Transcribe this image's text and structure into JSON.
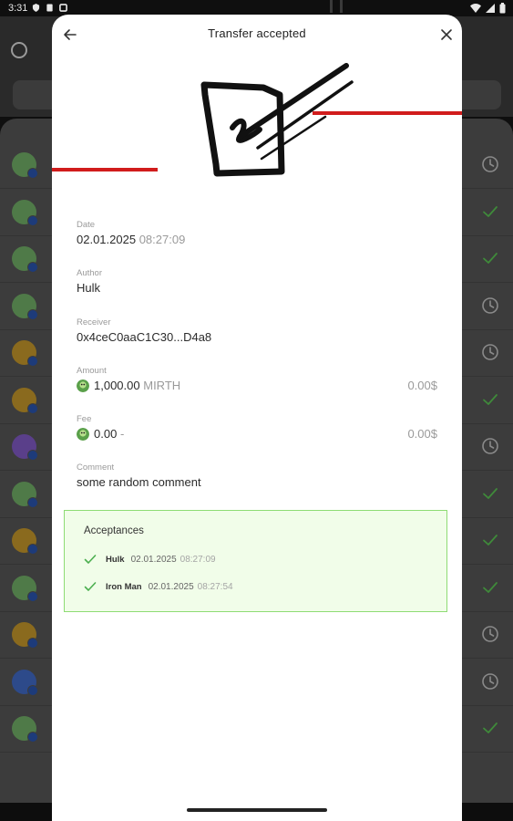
{
  "status_bar": {
    "time": "3:31"
  },
  "modal": {
    "title": "Transfer accepted",
    "fields": {
      "date": {
        "label": "Date",
        "date": "02.01.2025",
        "time": "08:27:09"
      },
      "author": {
        "label": "Author",
        "value": "Hulk"
      },
      "receiver": {
        "label": "Receiver",
        "value": "0x4ceC0aaC1C30...D4a8"
      },
      "amount": {
        "label": "Amount",
        "value": "1,000.00",
        "token": "MIRTH",
        "usd": "0.00$"
      },
      "fee": {
        "label": "Fee",
        "value": "0.00",
        "token": "-",
        "usd": "0.00$"
      },
      "comment": {
        "label": "Comment",
        "value": "some random comment"
      }
    },
    "acceptances": {
      "title": "Acceptances",
      "items": [
        {
          "name": "Hulk",
          "date": "02.01.2025",
          "time": "08:27:09"
        },
        {
          "name": "Iron Man",
          "date": "02.01.2025",
          "time": "08:27:54"
        }
      ]
    }
  },
  "colors": {
    "accent_red": "#d11c1c",
    "success_green": "#4caf50",
    "acceptance_bg": "#f1fde9",
    "acceptance_border": "#8edc74",
    "overlay_bg": "#3c3c3c"
  },
  "icons": {
    "back": "arrow-left-icon",
    "close": "close-icon",
    "check": "check-icon",
    "pending": "clock-icon"
  },
  "background_rows": [
    {
      "status": "pending"
    },
    {
      "status": "accepted"
    },
    {
      "status": "accepted"
    },
    {
      "status": "pending"
    },
    {
      "status": "pending"
    },
    {
      "status": "accepted"
    },
    {
      "status": "pending"
    },
    {
      "status": "accepted"
    },
    {
      "status": "accepted"
    },
    {
      "status": "accepted"
    },
    {
      "status": "pending"
    },
    {
      "status": "pending"
    },
    {
      "status": "accepted"
    }
  ]
}
